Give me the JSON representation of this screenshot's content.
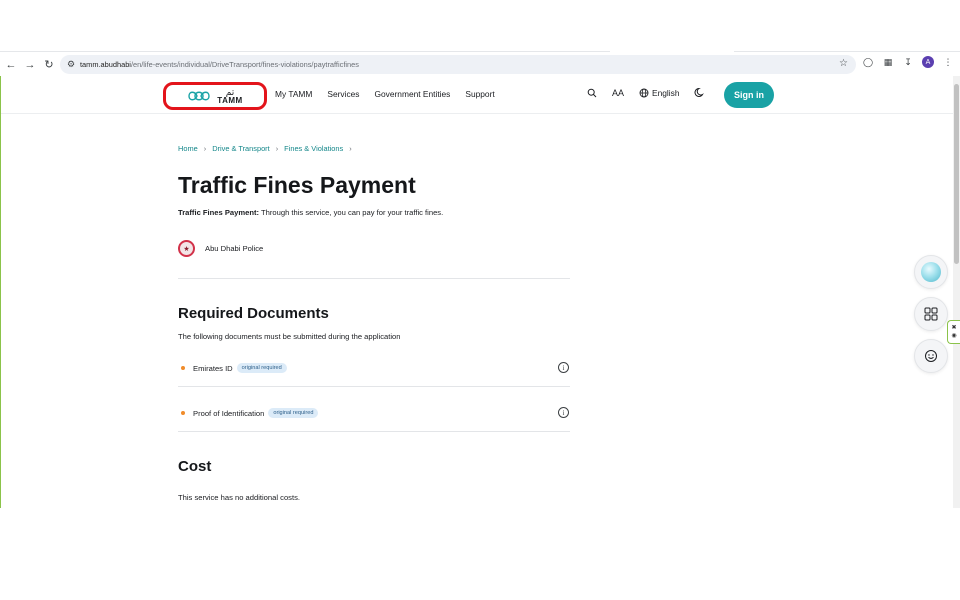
{
  "browser": {
    "url_host": "tamm.abudhabi",
    "url_path": "/en/life-events/individual/DriveTransport/fines-violations/paytrafficfines",
    "profile_initial": "A"
  },
  "header": {
    "logo_arabic": "تم",
    "logo_latin": "TAMM",
    "nav": [
      "My TAMM",
      "Services",
      "Government Entities",
      "Support"
    ],
    "font_size_label": "AA",
    "language": "English",
    "signin": "Sign in"
  },
  "breadcrumb": [
    "Home",
    "Drive & Transport",
    "Fines & Violations"
  ],
  "page": {
    "title": "Traffic Fines Payment",
    "intro_label": "Traffic Fines Payment:",
    "intro_text": " Through this service, you can pay for your traffic fines.",
    "provider": "Abu Dhabi Police"
  },
  "required_documents": {
    "title": "Required Documents",
    "subtitle": "The following documents must be submitted during the application",
    "items": [
      {
        "name": "Emirates ID",
        "badge": "original required"
      },
      {
        "name": "Proof of Identification",
        "badge": "original required"
      }
    ]
  },
  "cost": {
    "title": "Cost",
    "text": "This service has no additional costs."
  },
  "colors": {
    "accent": "#19a2a5",
    "link": "#14878a",
    "highlight_border": "#e3141b",
    "bullet": "#f08c2b"
  }
}
